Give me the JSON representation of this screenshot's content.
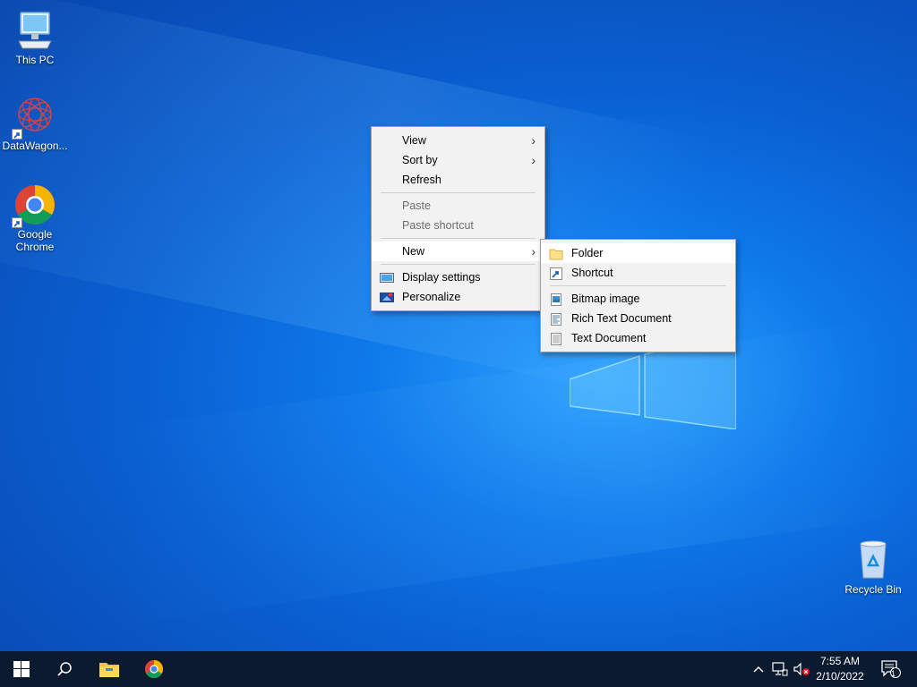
{
  "desktop_icons": [
    {
      "label": "This PC",
      "icon": "computer-icon"
    },
    {
      "label": "DataWagon...",
      "icon": "datawagon-icon"
    },
    {
      "label": "Google Chrome",
      "icon": "chrome-icon"
    },
    {
      "label": "Recycle Bin",
      "icon": "recycle-bin-icon"
    }
  ],
  "context_menu": {
    "items": [
      {
        "label": "View",
        "has_submenu": true
      },
      {
        "label": "Sort by",
        "has_submenu": true
      },
      {
        "label": "Refresh"
      },
      {
        "label": "Paste",
        "disabled": true
      },
      {
        "label": "Paste shortcut",
        "disabled": true
      },
      {
        "label": "New",
        "has_submenu": true,
        "active": true
      },
      {
        "label": "Display settings",
        "icon": "display-settings-icon"
      },
      {
        "label": "Personalize",
        "icon": "personalize-icon"
      }
    ]
  },
  "new_submenu": {
    "items": [
      {
        "label": "Folder",
        "icon": "folder-icon",
        "hovered": true
      },
      {
        "label": "Shortcut",
        "icon": "shortcut-icon"
      },
      {
        "label": "Bitmap image",
        "icon": "bitmap-icon"
      },
      {
        "label": "Rich Text Document",
        "icon": "rich-text-icon"
      },
      {
        "label": "Text Document",
        "icon": "text-document-icon"
      }
    ]
  },
  "taskbar": {
    "time": "7:55 AM",
    "date": "2/10/2022",
    "notification_count": "1"
  },
  "colors": {
    "taskbar": "#0b1a2f",
    "menu_background": "#f2f2f2",
    "desktop_accent": "#0e79ea"
  }
}
